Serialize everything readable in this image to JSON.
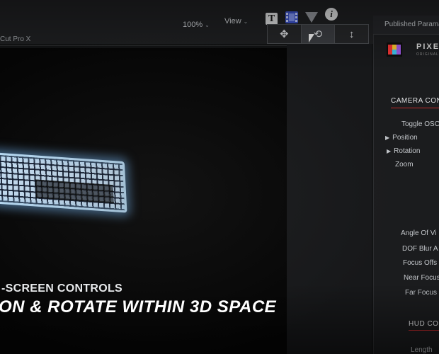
{
  "window": {
    "title_fragment": "Cut Pro X"
  },
  "toolbar": {
    "zoom_label": "100%",
    "view_label": "View",
    "icons": [
      "text-tool-icon",
      "filmstrip-icon",
      "mask-triangle-icon",
      "info-icon"
    ],
    "t_glyph": "T",
    "i_glyph": "i"
  },
  "onscreen_tools": [
    {
      "name": "move-tool",
      "glyph": "✥"
    },
    {
      "name": "rotate-tool",
      "glyph": "⟲"
    },
    {
      "name": "scale-tool",
      "glyph": "↕"
    }
  ],
  "inspector": {
    "header": "Published Parama",
    "logo_text": "PIXE",
    "logo_sub": "ORIGINAL",
    "camera_section": "CAMERA CON",
    "camera_params": [
      {
        "label": "Toggle OSC",
        "expandable": false
      },
      {
        "label": "Position",
        "expandable": true
      },
      {
        "label": "Rotation",
        "expandable": true
      },
      {
        "label": "Zoom",
        "expandable": false
      }
    ],
    "lens_params": [
      {
        "label": "Angle Of Vi"
      },
      {
        "label": "DOF Blur A"
      },
      {
        "label": "Focus Offs"
      },
      {
        "label": "Near Focus"
      },
      {
        "label": "Far Focus"
      }
    ],
    "hud_section": "HUD CO",
    "hud_first": "Length"
  },
  "caption": {
    "line1": "-SCREEN CONTROLS",
    "line2": "ON & ROTATE WITHIN 3D SPACE"
  },
  "colors": {
    "accent_red": "#c02a2a",
    "glow": "#bfe4ff",
    "filmstrip_blue": "#3b52c9"
  }
}
